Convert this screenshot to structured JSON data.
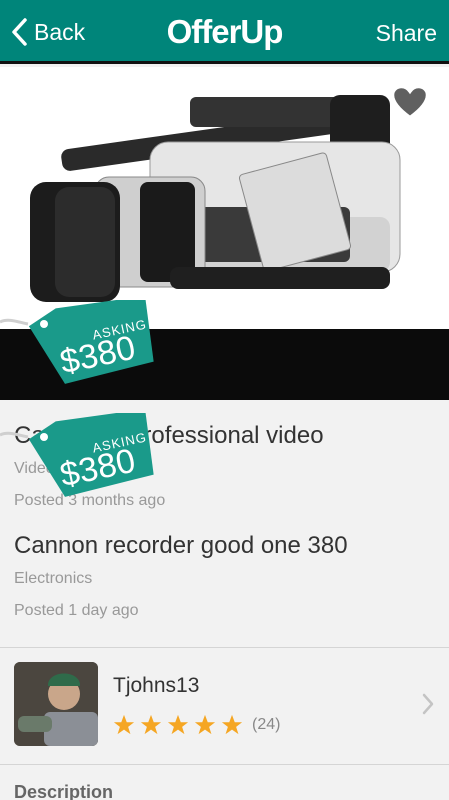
{
  "nav": {
    "back_label": "Back",
    "brand": "OfferUp",
    "share_label": "Share"
  },
  "photo": {
    "subject": "camcorder photo",
    "favorite_icon": "heart-icon"
  },
  "tags": [
    {
      "asking": "ASKING",
      "price": "$380"
    },
    {
      "asking": "ASKING",
      "price": "$380"
    }
  ],
  "listings": [
    {
      "title": "Canon gl2 professional video",
      "category": "Video",
      "posted": "Posted 3 months ago"
    },
    {
      "title": "Cannon recorder good one 380",
      "category": "Electronics",
      "posted": "Posted 1 day ago"
    }
  ],
  "seller": {
    "name": "Tjohns13",
    "rating_count": "(24)",
    "rating_stars": 5
  },
  "description_heading": "Description",
  "colors": {
    "brand": "#00857a",
    "star": "#f5a623",
    "tag": "#1a9a8a"
  }
}
